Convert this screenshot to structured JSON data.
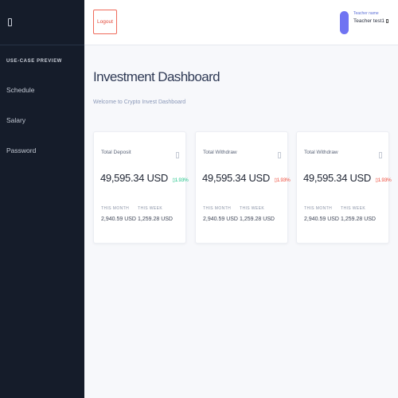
{
  "sidebar": {
    "menu_icon": "menu-icon",
    "section_title": "USE-CASE PREVIEW",
    "items": [
      {
        "label": "Schedule"
      },
      {
        "label": "Salary"
      },
      {
        "label": "Password"
      }
    ]
  },
  "header": {
    "logout_label": "Logout",
    "user_role": "Teacher name",
    "user_name": "Teacher test1",
    "caret_icon": "chevron-down-icon"
  },
  "main": {
    "title": "Investment Dashboard",
    "subtitle": "Welcome to Crypto Invest Dashboard",
    "cards": [
      {
        "title": "Total Deposit",
        "value": "49,595.34 USD",
        "change": "1.93%",
        "direction": "up",
        "month_label": "THIS MONTH",
        "month_value": "2,940.59 USD",
        "week_label": "THIS WEEK",
        "week_value": "1,259.28 USD"
      },
      {
        "title": "Total Withdraw",
        "value": "49,595.34 USD",
        "change": "1.93%",
        "direction": "down",
        "month_label": "THIS MONTH",
        "month_value": "2,940.59 USD",
        "week_label": "THIS WEEK",
        "week_value": "1,259.28 USD"
      },
      {
        "title": "Total Withdraw",
        "value": "49,595.34 USD",
        "change": "1.93%",
        "direction": "down",
        "month_label": "THIS MONTH",
        "month_value": "2,940.59 USD",
        "week_label": "THIS WEEK",
        "week_value": "1,259.28 USD"
      }
    ]
  },
  "colors": {
    "sidebar_bg": "#151c2a",
    "accent": "#6f73f2",
    "positive": "#22c48a",
    "negative": "#ee4b3b",
    "logout": "#e2493a"
  }
}
